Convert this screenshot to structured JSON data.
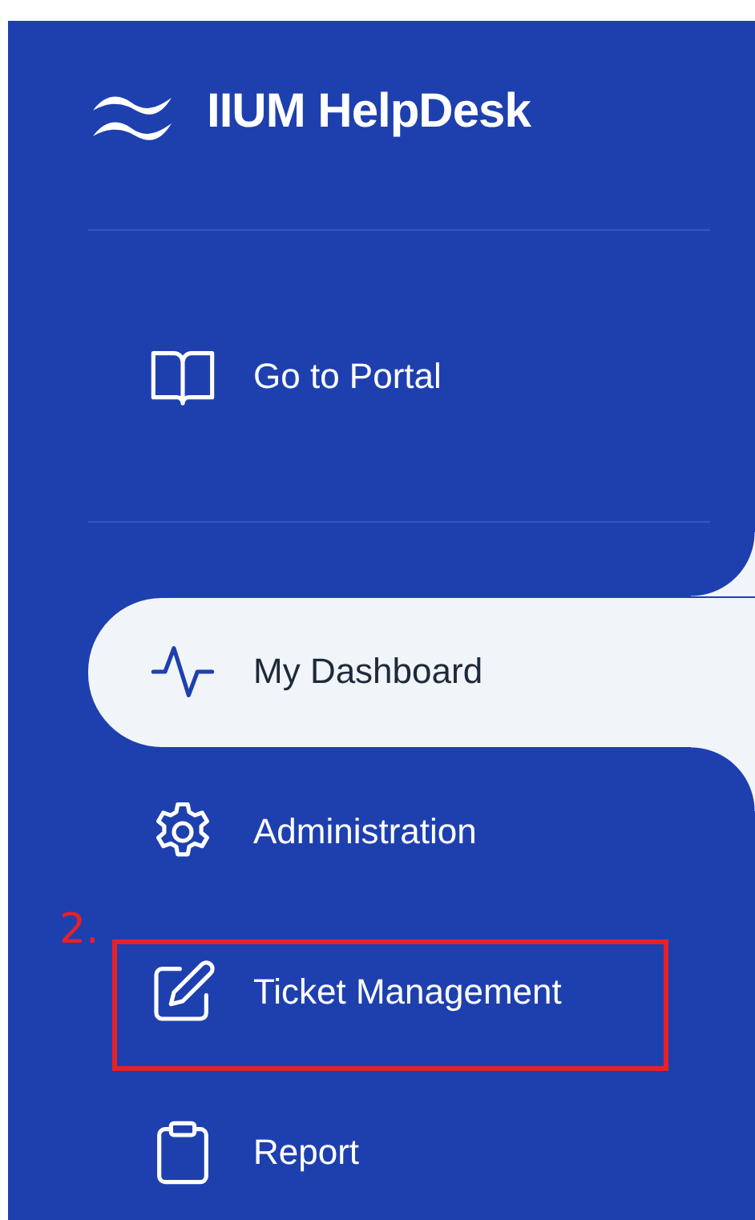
{
  "brand": {
    "title": "IIUM HelpDesk"
  },
  "nav_groups": [
    {
      "items": [
        {
          "label": "Go to Portal",
          "selected": false,
          "annotated": false
        }
      ]
    },
    {
      "items": [
        {
          "label": "My Dashboard",
          "selected": true,
          "annotated": false
        },
        {
          "label": "Administration",
          "selected": false,
          "annotated": false
        },
        {
          "label": "Ticket Management",
          "selected": false,
          "annotated": true
        },
        {
          "label": "Report",
          "selected": false,
          "annotated": false
        }
      ]
    }
  ],
  "annotation_label": "2."
}
